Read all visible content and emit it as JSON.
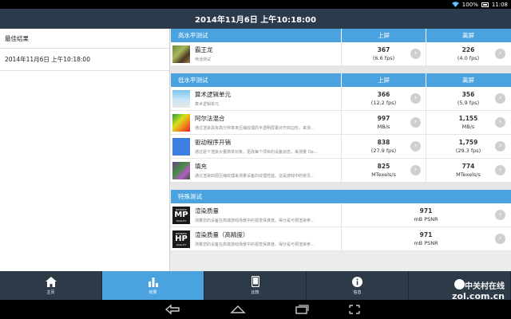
{
  "status_bar": {
    "battery_percent": "100%",
    "time": "11:08"
  },
  "header": {
    "title": "2014年11月6日 上午10:18:00"
  },
  "left_panel": {
    "heading": "最佳结果",
    "items": [
      {
        "label": "2014年11月6日 上午10:18:00"
      }
    ]
  },
  "sections": [
    {
      "title": "高水平测试",
      "col1": "上屏",
      "col2": "离屏",
      "rows": [
        {
          "name": "霸王龙",
          "desc": "电池测试",
          "thumb": "dragon",
          "on_value": "367",
          "on_sub": "(6.6 fps)",
          "off_value": "226",
          "off_sub": "(4.0 fps)"
        }
      ]
    },
    {
      "title": "低水平测试",
      "col1": "上屏",
      "col2": "离屏",
      "rows": [
        {
          "name": "算术逻辑单元",
          "desc": "算术逻辑单元",
          "thumb": "sky",
          "on_value": "366",
          "on_sub": "(12.2 fps)",
          "off_value": "356",
          "off_sub": "(5.9 fps)"
        },
        {
          "name": "阿尔法混合",
          "desc": "通过渲染具有高分辨率未压缩纹理的半透明屏幕对齐四边形，来测...",
          "thumb": "heat",
          "on_value": "997",
          "on_sub": "MB/s",
          "off_value": "1,155",
          "off_sub": "MB/s"
        },
        {
          "name": "驱动程序开销",
          "desc": "通过逐个渲染大量简单对象，更改每个项目的设备状态，来测量 Op...",
          "thumb": "blue",
          "on_value": "838",
          "on_sub": "(27.9 fps)",
          "off_value": "1,759",
          "off_sub": "(29.3 fps)"
        },
        {
          "name": "填充",
          "desc": "通过渲染四层压缩纹理来测量设备的纹理性能。这是游戏中的常见...",
          "thumb": "fill",
          "on_value": "825",
          "on_sub": "MTexels/s",
          "off_value": "774",
          "off_sub": "MTexels/s"
        }
      ]
    },
    {
      "title": "特殊测试",
      "rows": [
        {
          "name": "渲染质量",
          "desc": "测量您的设备在高端游戏场景中的视觉保真度。得分是与预渲染参...",
          "badge": "MP",
          "badge_top": "RENDER",
          "badge_bot": "QUALITY",
          "value": "971",
          "sub": "mB PSNR"
        },
        {
          "name": "渲染质量（高精度）",
          "desc": "测量您的设备在高端游戏场景中的视觉保真度。得分是与预渲染参...",
          "badge": "HP",
          "badge_top": "RENDER",
          "badge_bot": "QUALITY",
          "value": "971",
          "sub": "mB PSNR"
        }
      ]
    }
  ],
  "tabs": [
    {
      "label": "主页",
      "icon": "home-icon"
    },
    {
      "label": "结果",
      "icon": "bar-chart-icon",
      "active": true
    },
    {
      "label": "比较",
      "icon": "phone-icon"
    },
    {
      "label": "信息",
      "icon": "info-icon"
    },
    {
      "label": "",
      "icon": "more-icon"
    }
  ],
  "watermark": {
    "brand": "中关村在线",
    "url": "zol.com.cn"
  },
  "colors": {
    "header_bg": "#2b3b4c",
    "accent": "#4aa3df",
    "tabbar_bg": "#2d3a47"
  }
}
